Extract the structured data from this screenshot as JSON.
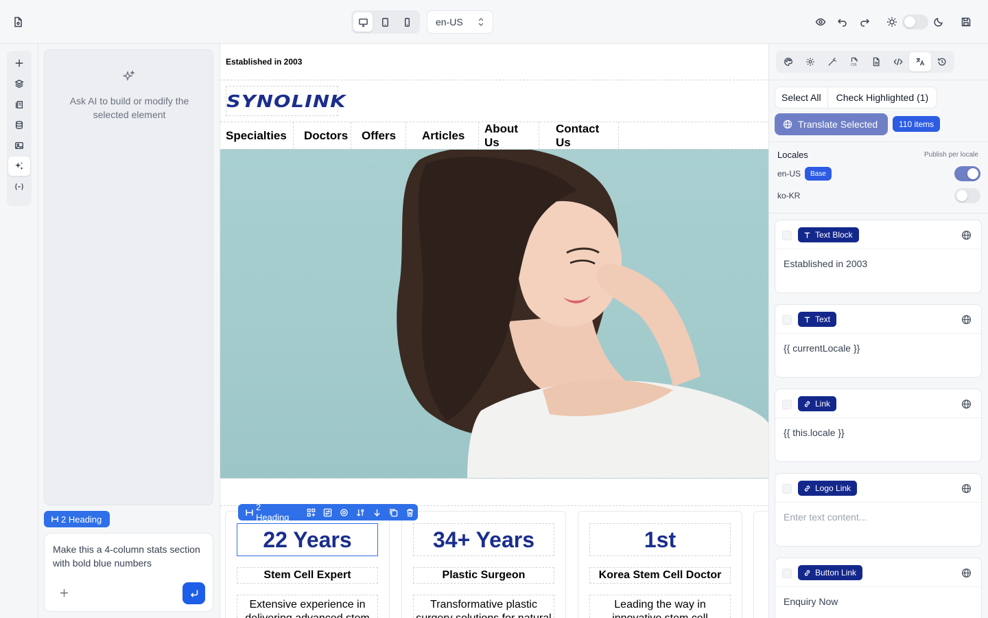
{
  "topbar": {
    "locale": "en-US",
    "devices": [
      "desktop",
      "tablet",
      "mobile"
    ],
    "active_device": "desktop",
    "theme_toggle_on": false
  },
  "rail": {
    "items": [
      "plus-icon",
      "layers-icon",
      "pages-icon",
      "database-icon",
      "image-icon",
      "sparkles-icon",
      "variable-icon"
    ],
    "active": "sparkles-icon"
  },
  "ai_panel": {
    "hint": "Ask AI to build or modify the selected element",
    "selected_chip": "2 Heading",
    "prompt": "Make this a 4-column stats section with bold blue numbers"
  },
  "canvas": {
    "established": "Established in 2003",
    "logo": "SYNOLINK",
    "nav": [
      "Specialties",
      "Doctors",
      "Offers",
      "Articles",
      "About Us",
      "Contact Us"
    ],
    "toolbar_label": "2 Heading",
    "stats": [
      {
        "number": "22 Years",
        "title": "Stem Cell Expert",
        "desc": "Extensive experience in delivering advanced stem"
      },
      {
        "number": "34+ Years",
        "title": "Plastic Surgeon",
        "desc": "Transformative plastic surgery solutions for natural"
      },
      {
        "number": "1st",
        "title": "Korea Stem Cell Doctor",
        "desc": "Leading the way in innovative stem cell"
      }
    ]
  },
  "right_panel": {
    "tabs": [
      "palette-icon",
      "settings-icon",
      "magic-wand-icon",
      "css-file-icon",
      "file-icon",
      "code-icon",
      "translate-icon",
      "history-icon"
    ],
    "active_tab": "translate-icon",
    "select_all": "Select All",
    "check_highlighted": "Check Highlighted (1)",
    "translate_selected": "Translate Selected",
    "items_count": "110 items",
    "locales_heading": "Locales",
    "publish_per_locale": "Publish per locale",
    "locales": [
      {
        "code": "en-US",
        "badge": "Base",
        "published": true
      },
      {
        "code": "ko-KR",
        "badge": "",
        "published": false
      }
    ],
    "cards": [
      {
        "tag": "Text Block",
        "icon": "text-icon",
        "value": "Established in 2003",
        "placeholder": false
      },
      {
        "tag": "Text",
        "icon": "text-icon",
        "value": "{{ currentLocale }}",
        "placeholder": false
      },
      {
        "tag": "Link",
        "icon": "link-icon",
        "value": "{{ this.locale }}",
        "placeholder": false
      },
      {
        "tag": "Logo Link",
        "icon": "link-icon",
        "value": "Enter text content...",
        "placeholder": true
      },
      {
        "tag": "Button Link",
        "icon": "link-icon",
        "value": "Enquiry Now",
        "placeholder": false
      }
    ]
  }
}
